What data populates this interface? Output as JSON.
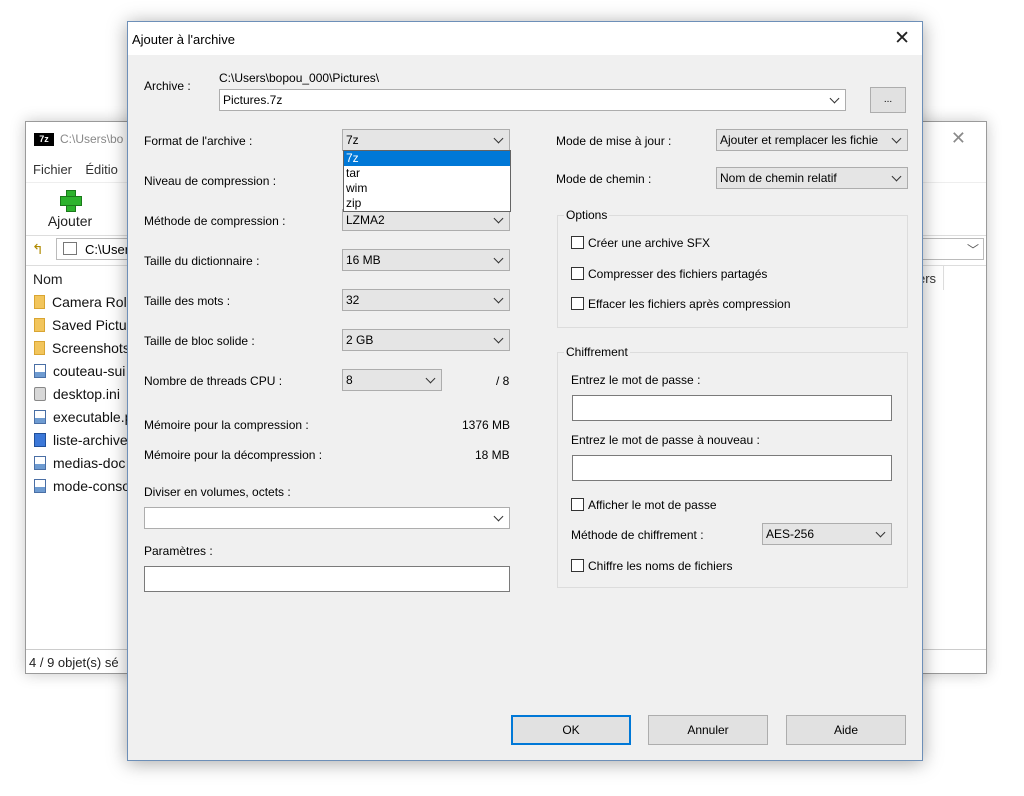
{
  "file_manager": {
    "title": "C:\\Users\\bo",
    "app_logo": "7z",
    "menu": [
      "Fichier",
      "Éditio"
    ],
    "toolbar": {
      "add_label": "Ajouter"
    },
    "address": "C:\\User",
    "columns": {
      "name": "Nom",
      "right_partial": "ers"
    },
    "files": [
      {
        "name": "Camera Rol",
        "icon": "folder-icon"
      },
      {
        "name": "Saved Pictur",
        "icon": "folder-icon"
      },
      {
        "name": "Screenshots",
        "icon": "folder-icon"
      },
      {
        "name": "couteau-sui",
        "icon": "image-file-icon"
      },
      {
        "name": "desktop.ini",
        "icon": "settings-file-icon"
      },
      {
        "name": "executable.p",
        "icon": "image-file-icon"
      },
      {
        "name": "liste-archive",
        "icon": "selected-file-icon"
      },
      {
        "name": "medias-doc",
        "icon": "image-file-icon"
      },
      {
        "name": "mode-conso",
        "icon": "image-file-icon"
      }
    ],
    "status": "4 / 9 objet(s) sé"
  },
  "dialog": {
    "title": "Ajouter à l'archive",
    "archive": {
      "label": "Archive :",
      "path": "C:\\Users\\bopou_000\\Pictures\\",
      "filename": "Pictures.7z",
      "browse_label": "..."
    },
    "left": {
      "format_label": "Format de l'archive :",
      "format_value": "7z",
      "format_options": [
        "7z",
        "tar",
        "wim",
        "zip"
      ],
      "level_label": "Niveau de compression :",
      "method_label": "Méthode de compression :",
      "method_value": "LZMA2",
      "dict_label": "Taille du dictionnaire :",
      "dict_value": "16 MB",
      "word_label": "Taille des mots :",
      "word_value": "32",
      "solid_label": "Taille de bloc solide :",
      "solid_value": "2 GB",
      "threads_label": "Nombre de threads CPU :",
      "threads_value": "8",
      "threads_max": "/ 8",
      "mem_comp_label": "Mémoire pour la compression :",
      "mem_comp_value": "1376 MB",
      "mem_decomp_label": "Mémoire pour la décompression :",
      "mem_decomp_value": "18 MB",
      "split_label": "Diviser en volumes, octets :",
      "params_label": "Paramètres :"
    },
    "right": {
      "update_label": "Mode de mise à jour :",
      "update_value": "Ajouter et remplacer les fichie",
      "path_mode_label": "Mode de chemin :",
      "path_mode_value": "Nom de chemin relatif",
      "options_title": "Options",
      "options": [
        "Créer une archive SFX",
        "Compresser des fichiers partagés",
        "Effacer les fichiers après compression"
      ],
      "encryption_title": "Chiffrement",
      "password_label": "Entrez le mot de passe :",
      "password_again_label": "Entrez le mot de passe à nouveau :",
      "show_password": "Afficher le mot de passe",
      "enc_method_label": "Méthode de chiffrement :",
      "enc_method_value": "AES-256",
      "encrypt_names": "Chiffre les noms de fichiers"
    },
    "buttons": {
      "ok": "OK",
      "cancel": "Annuler",
      "help": "Aide"
    }
  },
  "colors": {
    "selection": "#0078d7",
    "dialog_bg": "#f0f0f0",
    "button_bg": "#e1e1e1"
  }
}
